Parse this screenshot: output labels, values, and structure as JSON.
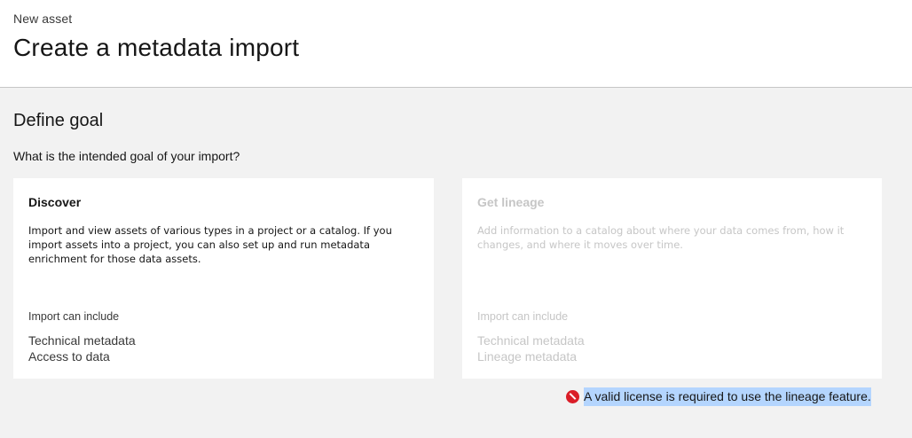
{
  "header": {
    "eyebrow": "New asset",
    "title": "Create a metadata import"
  },
  "main": {
    "section_title": "Define goal",
    "question": "What is the intended goal of your import?",
    "cards": [
      {
        "title": "Discover",
        "description": "Import and view assets of various types in a project or a catalog. If you import assets into a project, you can also set up and run metadata enrichment for those data assets.",
        "subheading": "Import can include",
        "items": [
          "Technical metadata",
          "Access to data"
        ],
        "disabled": false
      },
      {
        "title": "Get lineage",
        "description": "Add information to a catalog about where your data comes from, how it changes, and where it moves over time.",
        "subheading": "Import can include",
        "items": [
          "Technical metadata",
          "Lineage metadata"
        ],
        "disabled": true
      }
    ],
    "error": {
      "icon": "error-icon",
      "message": "A valid license is required to use the lineage feature.",
      "color": "#da1e28"
    }
  }
}
